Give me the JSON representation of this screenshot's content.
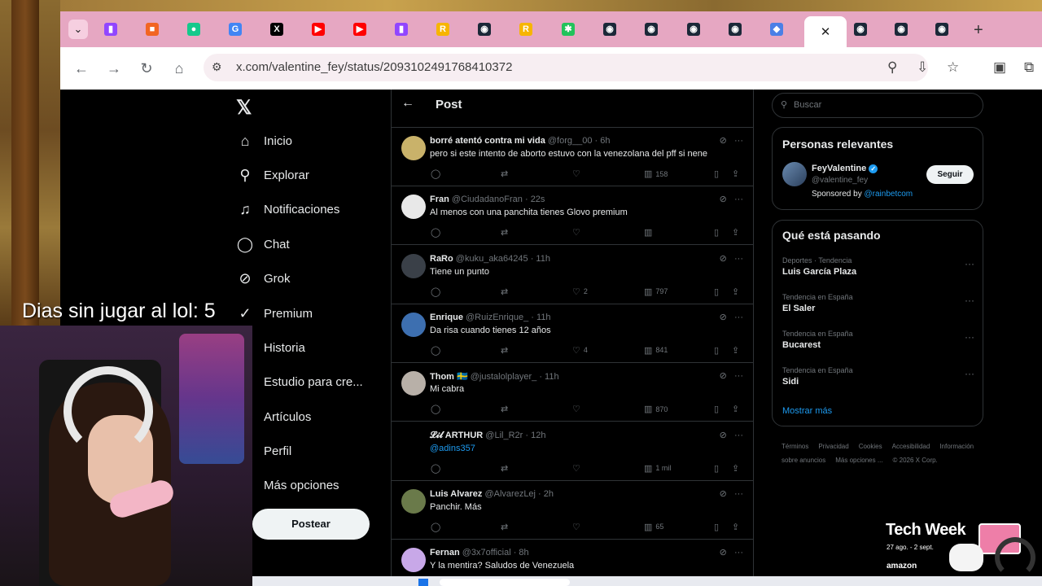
{
  "browser": {
    "url": "x.com/valentine_fey/status/2093102491768410372",
    "tabs": [
      {
        "icon": "twitch-icon",
        "color": "#9146ff",
        "glyph": "▮"
      },
      {
        "icon": "orange-app-icon",
        "color": "#f26522",
        "glyph": "■"
      },
      {
        "icon": "green-bot-icon",
        "color": "#14c98b",
        "glyph": "●"
      },
      {
        "icon": "google-icon",
        "color": "#4285f4",
        "glyph": "G"
      },
      {
        "icon": "x-icon",
        "color": "#000000",
        "glyph": "X"
      },
      {
        "icon": "youtube-icon",
        "color": "#ff0000",
        "glyph": "▶"
      },
      {
        "icon": "youtube-icon",
        "color": "#ff0000",
        "glyph": "▶"
      },
      {
        "icon": "twitch-icon",
        "color": "#9146ff",
        "glyph": "▮"
      },
      {
        "icon": "rockstar-icon",
        "color": "#f7b500",
        "glyph": "R"
      },
      {
        "icon": "steam-icon",
        "color": "#1b2838",
        "glyph": "◉"
      },
      {
        "icon": "rockstar-icon",
        "color": "#f7b500",
        "glyph": "R"
      },
      {
        "icon": "green-star-icon",
        "color": "#21c35b",
        "glyph": "✱"
      },
      {
        "icon": "steam-icon",
        "color": "#1b2838",
        "glyph": "◉"
      },
      {
        "icon": "steam-icon",
        "color": "#1b2838",
        "glyph": "◉"
      },
      {
        "icon": "steam-icon",
        "color": "#1b2838",
        "glyph": "◉"
      },
      {
        "icon": "steam-icon",
        "color": "#1b2838",
        "glyph": "◉"
      },
      {
        "icon": "blue-app-icon",
        "color": "#4a7fe6",
        "glyph": "◆"
      }
    ],
    "active_tab_close": "✕",
    "tabs_after": [
      {
        "icon": "steam-icon",
        "color": "#1b2838",
        "glyph": "◉"
      },
      {
        "icon": "steam-icon",
        "color": "#1b2838",
        "glyph": "◉"
      },
      {
        "icon": "steam-icon",
        "color": "#1b2838",
        "glyph": "◉"
      }
    ],
    "new_tab": "+"
  },
  "nav": {
    "items": [
      {
        "label": "Inicio",
        "icon": "home-icon",
        "glyph": "⌂"
      },
      {
        "label": "Explorar",
        "icon": "search-icon",
        "glyph": "⚲"
      },
      {
        "label": "Notificaciones",
        "icon": "bell-icon",
        "glyph": "♫"
      },
      {
        "label": "Chat",
        "icon": "chat-icon",
        "glyph": "◯"
      },
      {
        "label": "Grok",
        "icon": "grok-icon",
        "glyph": "⊘"
      },
      {
        "label": "Premium",
        "icon": "premium-icon",
        "glyph": "✓"
      },
      {
        "label": "Historia",
        "icon": "history-icon",
        "glyph": ""
      },
      {
        "label": "Estudio para cre...",
        "icon": "studio-icon",
        "glyph": ""
      },
      {
        "label": "Artículos",
        "icon": "articles-icon",
        "glyph": ""
      },
      {
        "label": "Perfil",
        "icon": "profile-icon",
        "glyph": ""
      },
      {
        "label": "Más opciones",
        "icon": "more-options-icon",
        "glyph": ""
      }
    ],
    "post_button": "Postear"
  },
  "main": {
    "title": "Post",
    "tweets": [
      {
        "name": "borré atentó contra mi vida",
        "handle": "@forg__00",
        "time": "6h",
        "text": "pero si este intento de aborto estuvo con la venezolana del pff si nene",
        "reply": "",
        "retweet": "",
        "like": "",
        "views": "158",
        "avatar_color": "#c9b26a"
      },
      {
        "name": "Fran",
        "handle": "@CiudadanoFran",
        "time": "22s",
        "text": "Al menos con una panchita tienes Glovo premium",
        "reply": "",
        "retweet": "",
        "like": "",
        "views": "",
        "avatar_color": "#e8e8e8"
      },
      {
        "name": "RaRo",
        "handle": "@kuku_aka64245",
        "time": "11h",
        "text": "Tiene un punto",
        "reply": "",
        "retweet": "",
        "like": "2",
        "views": "797",
        "avatar_color": "#3a4048"
      },
      {
        "name": "Enrique",
        "handle": "@RuizEnrique_",
        "time": "11h",
        "text": "Da risa cuando tienes 12 años",
        "reply": "",
        "retweet": "",
        "like": "4",
        "views": "841",
        "avatar_color": "#3d6fb0"
      },
      {
        "name": "Thom 🇸🇪",
        "handle": "@justalolplayer_",
        "time": "11h",
        "text": "Mi cabra",
        "reply": "",
        "retweet": "",
        "like": "",
        "views": "870",
        "avatar_color": "#b8b0a8"
      },
      {
        "name": "𝓛𝓲𝓵 ARTHUR",
        "handle": "@Lil_R2r",
        "time": "12h",
        "text": "@adins357",
        "reply": "",
        "retweet": "",
        "like": "",
        "views": "1 mil",
        "avatar_color": "#000000"
      },
      {
        "name": "Luis Alvarez",
        "handle": "@AlvarezLej",
        "time": "2h",
        "text": "Panchir. Más",
        "reply": "",
        "retweet": "",
        "like": "",
        "views": "65",
        "avatar_color": "#6a7a4a"
      },
      {
        "name": "Fernan",
        "handle": "@3x7official",
        "time": "8h",
        "text": "Y la mentira? Saludos de Venezuela",
        "reply": "",
        "retweet": "",
        "like": "",
        "views": "",
        "avatar_color": "#c8a8e8"
      }
    ]
  },
  "right": {
    "search_placeholder": "Buscar",
    "relevant_title": "Personas relevantes",
    "relevant": {
      "name": "FeyValentine",
      "handle": "@valentine_fey",
      "sponsored_prefix": "Sponsored by",
      "sponsored_link": "@rainbetcom",
      "follow": "Seguir"
    },
    "trends_title": "Qué está pasando",
    "trends": [
      {
        "category": "Deportes · Tendencia",
        "name": "Luis García Plaza"
      },
      {
        "category": "Tendencia en España",
        "name": "El Saler"
      },
      {
        "category": "Tendencia en España",
        "name": "Bucarest"
      },
      {
        "category": "Tendencia en España",
        "name": "Sidi"
      }
    ],
    "show_more": "Mostrar más",
    "footer": [
      "Términos",
      "Privacidad",
      "Cookies",
      "Accesibilidad",
      "Información sobre anuncios",
      "Más opciones ...",
      "© 2026 X Corp."
    ]
  },
  "overlay": {
    "counter": "Dias sin jugar al lol: 5",
    "promo_title": "Tech Week",
    "promo_dates": "27 ago. - 2 sept.",
    "promo_brand": "amazon"
  }
}
